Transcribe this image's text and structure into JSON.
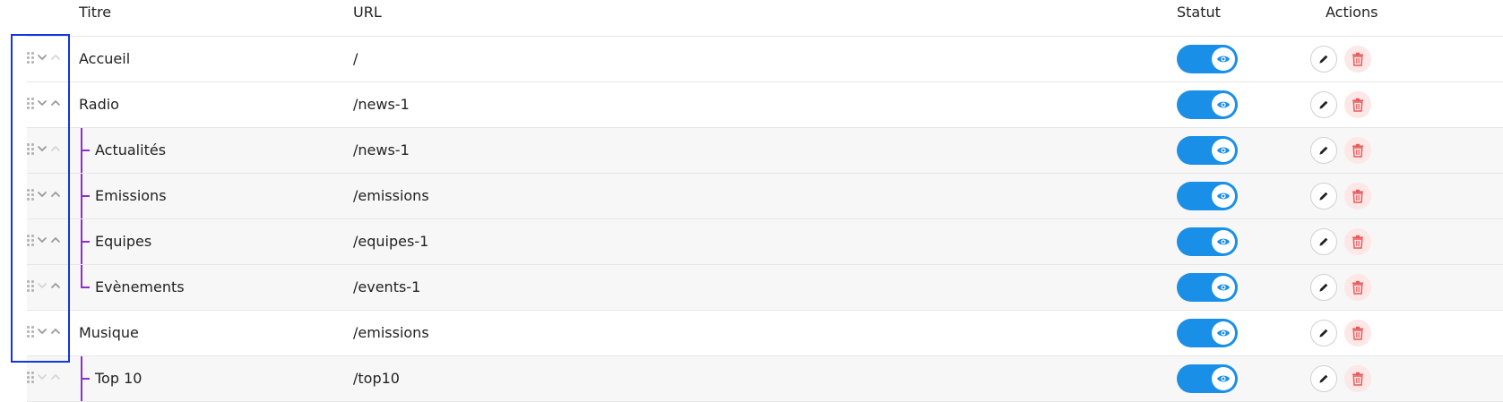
{
  "columns": {
    "title": "Titre",
    "url": "URL",
    "status": "Statut",
    "actions": "Actions"
  },
  "rows": [
    {
      "title": "Accueil",
      "url": "/",
      "level": 0,
      "status": "visible"
    },
    {
      "title": "Radio",
      "url": "/news-1",
      "level": 0,
      "status": "visible"
    },
    {
      "title": "Actualités",
      "url": "/news-1",
      "level": 1,
      "status": "visible"
    },
    {
      "title": "Emissions",
      "url": "/emissions",
      "level": 1,
      "status": "visible"
    },
    {
      "title": "Equipes",
      "url": "/equipes-1",
      "level": 1,
      "status": "visible"
    },
    {
      "title": "Evènements",
      "url": "/events-1",
      "level": 1,
      "status": "visible"
    },
    {
      "title": "Musique",
      "url": "/emissions",
      "level": 0,
      "status": "visible"
    },
    {
      "title": "Top 10",
      "url": "/top10",
      "level": 1,
      "status": "visible"
    }
  ],
  "colors": {
    "toggle_on": "#1a8fe8",
    "tree_line": "#8b2fd0",
    "delete_bg": "#fde7e7",
    "delete_icon": "#e85a5a",
    "selection_outline": "#1237e0"
  },
  "icons": {
    "drag": "drag-handle-icon",
    "move_down": "chevron-down-icon",
    "move_up": "chevron-up-icon",
    "visible": "eye-icon",
    "edit": "pencil-icon",
    "delete": "trash-icon"
  }
}
